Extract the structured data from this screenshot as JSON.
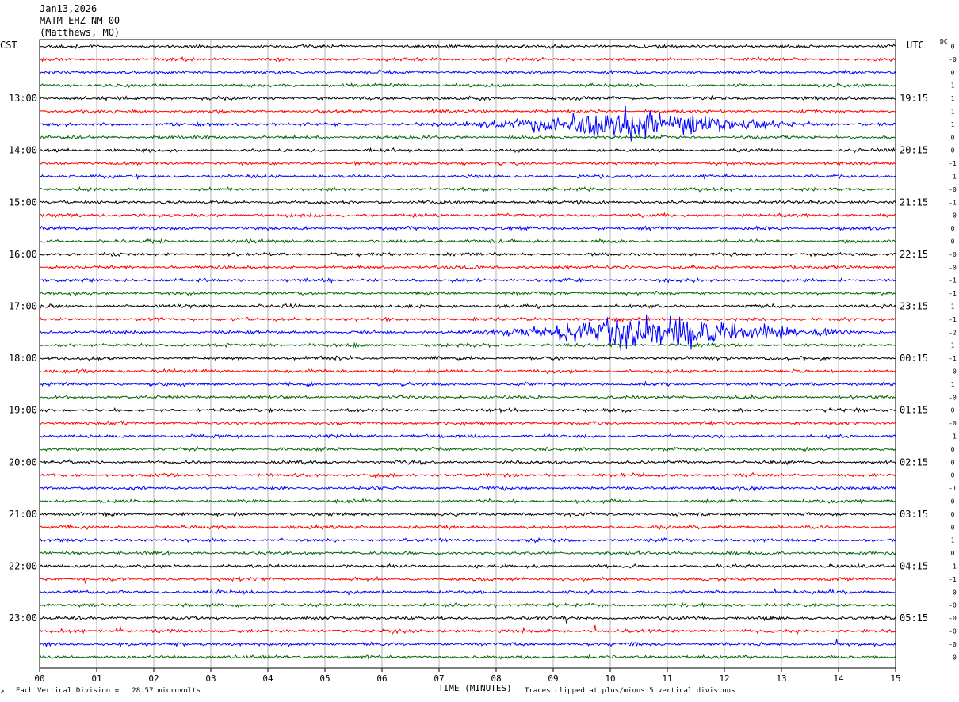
{
  "header": {
    "date": "Jan13,2026",
    "station": "MATM EHZ NM 00",
    "location": "(Matthews, MO)"
  },
  "left_tz": "CST",
  "right_tz": "UTC",
  "dc_label": "DC",
  "footer": {
    "vertical_division": "Each Vertical Division =   28.57 microvolts",
    "clip_note": "Traces clipped at plus/minus 5 vertical divisions",
    "corner_mark": "↗"
  },
  "colors": {
    "trace_cycle": [
      "#000000",
      "#ff0000",
      "#0000ff",
      "#006400"
    ],
    "grid": "#808080",
    "background": "#ffffff"
  },
  "chart_data": {
    "type": "line",
    "title": "",
    "xlabel": "TIME (MINUTES)",
    "ylabel": "",
    "xlim": [
      0,
      15
    ],
    "x_ticks": [
      "00",
      "01",
      "02",
      "03",
      "04",
      "05",
      "06",
      "07",
      "08",
      "09",
      "10",
      "11",
      "12",
      "13",
      "14",
      "15"
    ],
    "trace_count": 48,
    "trace_interval_minutes": 15,
    "left_hour_labels": [
      "13:00",
      "14:00",
      "15:00",
      "16:00",
      "17:00",
      "18:00",
      "19:00",
      "20:00",
      "21:00",
      "22:00",
      "23:00"
    ],
    "right_hour_labels": [
      "19:15",
      "20:15",
      "21:15",
      "22:15",
      "23:15",
      "00:15",
      "01:15",
      "02:15",
      "03:15",
      "04:15",
      "05:15"
    ],
    "dc_offsets": [
      "0",
      "-0",
      "0",
      "1",
      "1",
      "1",
      "1",
      "0",
      "0",
      "-1",
      "-1",
      "-0",
      "-1",
      "-0",
      "0",
      "0",
      "-0",
      "-0",
      "-1",
      "-1",
      "1",
      "-1",
      "-2",
      "1",
      "-1",
      "-0",
      "1",
      "-0",
      "0",
      "-0",
      "-1",
      "0",
      "0",
      "0",
      "-1",
      "0",
      "0",
      "0",
      "1",
      "0",
      "-1",
      "-1",
      "-0",
      "-0",
      "-0",
      "-0",
      "-0",
      "-0"
    ],
    "events": [
      {
        "trace": 6,
        "start_min": 6.0,
        "peak_min": 10.2,
        "end_min": 14.0,
        "peak_divisions": 5
      },
      {
        "trace": 22,
        "start_min": 6.2,
        "peak_min": 10.5,
        "end_min": 15.0,
        "peak_divisions": 5
      }
    ]
  }
}
